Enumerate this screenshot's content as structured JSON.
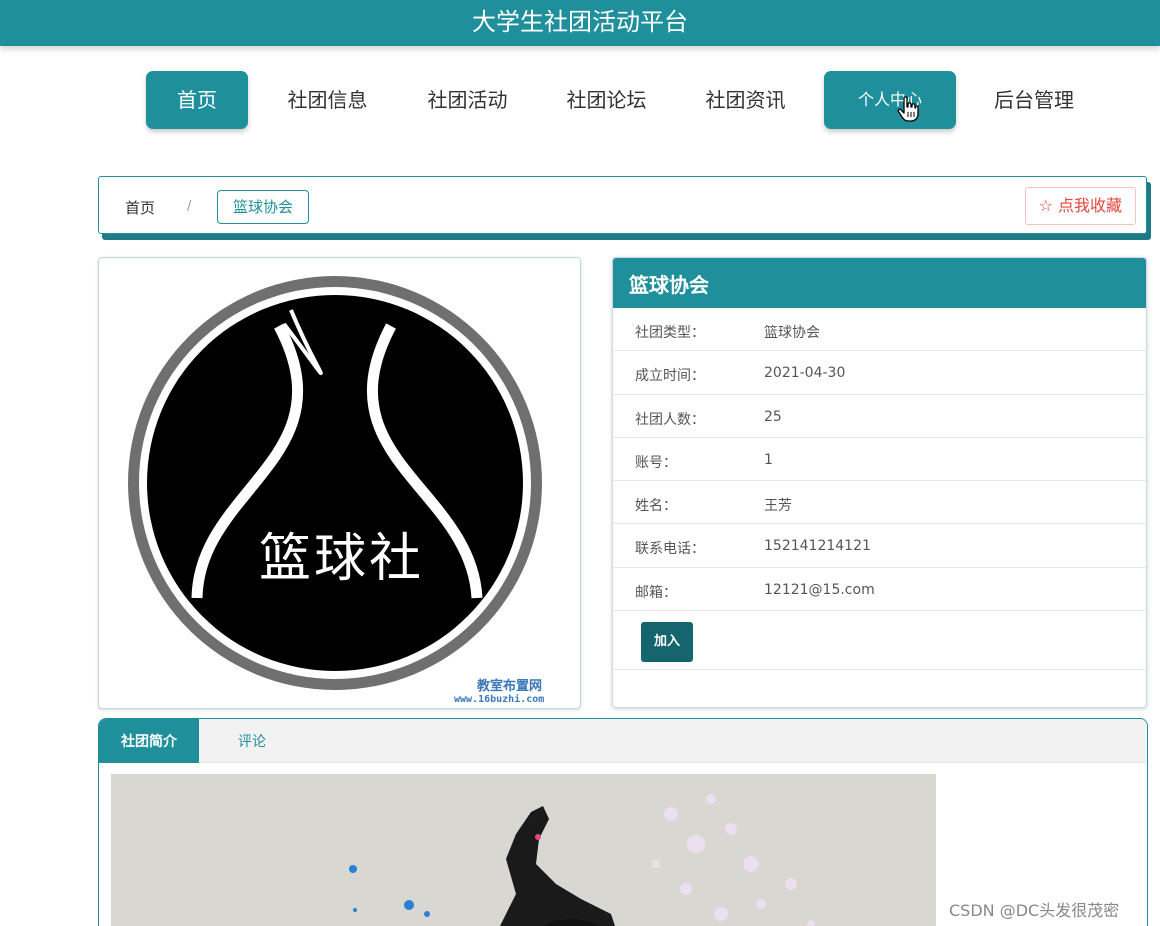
{
  "site": {
    "title": "大学生社团活动平台"
  },
  "nav": {
    "items": [
      {
        "label": "首页"
      },
      {
        "label": "社团信息"
      },
      {
        "label": "社团活动"
      },
      {
        "label": "社团论坛"
      },
      {
        "label": "社团资讯"
      },
      {
        "label": "个人中心"
      },
      {
        "label": "后台管理"
      }
    ]
  },
  "breadcrumb": {
    "home": "首页",
    "separator": "/",
    "current": "篮球协会"
  },
  "favorite": {
    "label": "☆ 点我收藏"
  },
  "logo": {
    "text": "篮球社",
    "watermark_line1": "教室布置网",
    "watermark_line2": "www.16buzhi.com"
  },
  "club": {
    "name": "篮球协会",
    "fields": [
      {
        "label": "社团类型：",
        "value": "篮球协会"
      },
      {
        "label": "成立时间：",
        "value": "2021-04-30"
      },
      {
        "label": "社团人数：",
        "value": "25"
      },
      {
        "label": "账号：",
        "value": "1"
      },
      {
        "label": "姓名：",
        "value": "王芳"
      },
      {
        "label": "联系电话：",
        "value": "152141214121"
      },
      {
        "label": "邮箱：",
        "value": "12121@15.com"
      }
    ],
    "join_label": "加入"
  },
  "tabs": [
    {
      "label": "社团简介"
    },
    {
      "label": "评论"
    }
  ],
  "footer": {
    "watermark": "CSDN @DC头发很茂密"
  },
  "colors": {
    "primary": "#1f8f9b",
    "dark_primary": "#15646e",
    "favorite_red": "#e4473b"
  }
}
